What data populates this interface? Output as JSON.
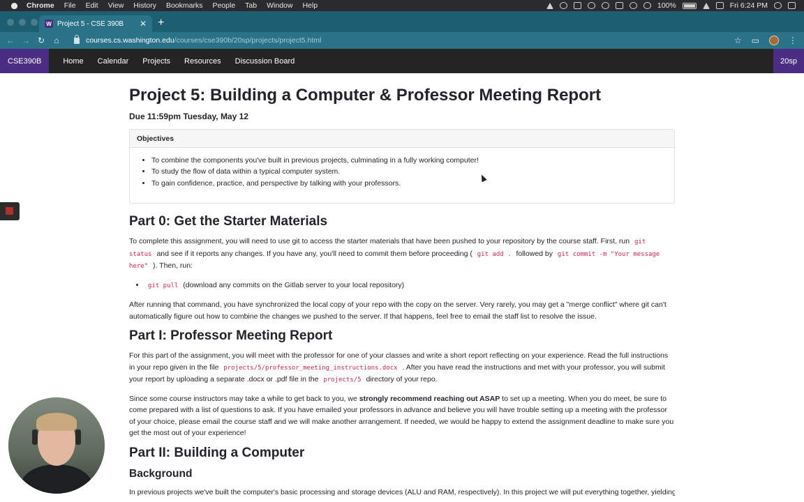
{
  "menubar": {
    "app": "Chrome",
    "items": [
      "File",
      "Edit",
      "View",
      "History",
      "Bookmarks",
      "People",
      "Tab",
      "Window",
      "Help"
    ],
    "battery": "100%",
    "clock": "Fri 6:24 PM"
  },
  "browser": {
    "tab_title": "Project 5 - CSE 390B",
    "favicon": "W",
    "url_host": "courses.cs.washington.edu",
    "url_path": "/courses/cse390b/20sp/projects/project5.html"
  },
  "sitenav": {
    "brand": "CSE390B",
    "links": [
      "Home",
      "Calendar",
      "Projects",
      "Resources",
      "Discussion Board"
    ],
    "term": "20sp"
  },
  "page": {
    "title": "Project 5: Building a Computer & Professor Meeting Report",
    "due": "Due 11:59pm Tuesday, May 12",
    "objectives": {
      "heading": "Objectives",
      "items": [
        "To combine the components you've built in previous projects, culminating in a fully working computer!",
        "To study the flow of data within a typical computer system.",
        "To gain confidence, practice, and perspective by talking with your professors."
      ]
    },
    "part0": {
      "heading": "Part 0: Get the Starter Materials",
      "p1_a": "To complete this assignment, you will need to use git to access the starter materials that have been pushed to your repository by the course staff. First, run",
      "p1_code1": "git status",
      "p1_b": "and see if it reports any changes. If you have any, you'll need to commit them before proceeding (",
      "p1_code2": "git add .",
      "p1_c": "followed by",
      "p1_code3": "git commit -m \"Your message here\"",
      "p1_d": "). Then, run:",
      "cmd_code": "git pull",
      "cmd_text": "(download any commits on the Gitlab server to your local repository)",
      "p2": "After running that command, you have synchronized the local copy of your repo with the copy on the server. Very rarely, you may get a \"merge conflict\" where git can't automatically figure out how to combine the changes we pushed to the server. If that happens, feel free to email the staff list to resolve the issue."
    },
    "part1": {
      "heading": "Part I: Professor Meeting Report",
      "p1_a": "For this part of the assignment, you will meet with the professor for one of your classes and write a short report reflecting on your experience. Read the full instructions in your repo given in the file",
      "p1_code1": "projects/5/professor_meeting_instructions.docx",
      "p1_b": ". After you have read the instructions and met with your professor, you will submit your report by uploading a separate .docx or .pdf file in the",
      "p1_code2": "projects/5",
      "p1_c": "directory of your repo.",
      "p2_a": "Since some course instructors may take a while to get back to you, we",
      "p2_bold": "strongly recommend reaching out ASAP",
      "p2_b": "to set up a meeting. When you do meet, be sure to come prepared with a list of questions to ask. If you have emailed your professors in advance and believe you will have trouble setting up a meeting with the professor of your choice, please email the course staff and we will make another arrangement. If needed, we would be happy to extend the assignment deadline to make sure you get the most out of your experience!"
    },
    "part2": {
      "heading": "Part II: Building a Computer",
      "subheading": "Background",
      "p1": "In previous projects we've built the computer's basic processing and storage devices (ALU and RAM, respectively). In this project we will put everything together, yielding"
    }
  }
}
